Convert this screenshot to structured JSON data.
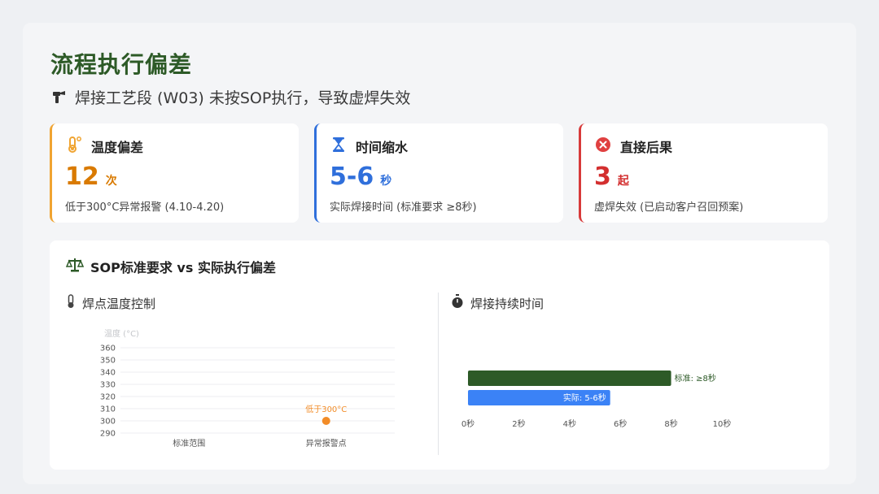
{
  "title": "流程执行偏差",
  "subtitle": "焊接工艺段 (W03) 未按SOP执行，导致虚焊失效",
  "cards": [
    {
      "label": "温度偏差",
      "value": "12",
      "unit": "次",
      "desc": "低于300°C异常报警 (4.10-4.20)",
      "icon": "thermometer-icon",
      "color": "#f0a431"
    },
    {
      "label": "时间缩水",
      "value": "5-6",
      "unit": "秒",
      "desc": "实际焊接时间 (标准要求 ≥8秒)",
      "icon": "hourglass-icon",
      "color": "#2f6fdb"
    },
    {
      "label": "直接后果",
      "value": "3",
      "unit": "起",
      "desc": "虚焊失效 (已启动客户召回预案)",
      "icon": "error-circle-icon",
      "color": "#d83a3a"
    }
  ],
  "panel": {
    "title": "SOP标准要求 vs 实际执行偏差",
    "left_title": "焊点温度控制",
    "right_title": "焊接持续时间"
  },
  "chart_data": [
    {
      "type": "scatter",
      "title": "焊点温度控制",
      "ylabel": "温度 (°C)",
      "categories": [
        "标准范围",
        "异常报警点"
      ],
      "ylim": [
        290,
        360
      ],
      "yticks": [
        290,
        300,
        310,
        320,
        330,
        340,
        350,
        360
      ],
      "points": [
        {
          "x": "异常报警点",
          "y": 300,
          "label": "低于300°C",
          "color": "#f28c28"
        }
      ],
      "grid": true
    },
    {
      "type": "bar",
      "orientation": "horizontal",
      "title": "焊接持续时间",
      "categories": [
        "标准",
        "实际"
      ],
      "bars": [
        {
          "start": 0,
          "end": 8,
          "label": "标准: ≥8秒",
          "label_position": "outside",
          "color": "#2d5a27"
        },
        {
          "start": 0,
          "end": 5.6,
          "label": "实际: 5-6秒",
          "label_position": "inside",
          "color": "#3b82f6"
        }
      ],
      "xlim": [
        0,
        10
      ],
      "xticks": [
        0,
        2,
        4,
        6,
        8,
        10
      ],
      "xtick_labels": [
        "0秒",
        "2秒",
        "4秒",
        "6秒",
        "8秒",
        "10秒"
      ]
    }
  ]
}
